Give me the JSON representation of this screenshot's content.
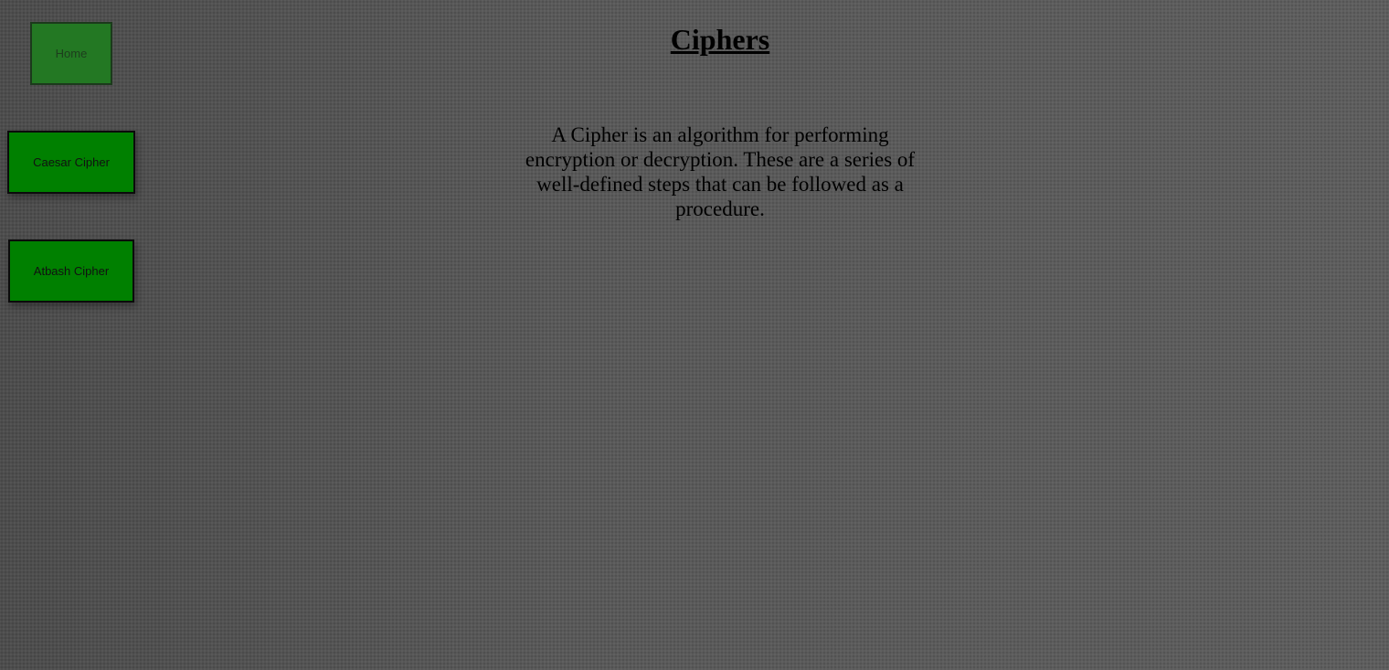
{
  "nav": {
    "home_label": "Home",
    "caesar_label": "Caesar Cipher",
    "atbash_label": "Atbash Cipher"
  },
  "main": {
    "title": "Ciphers",
    "description": "A Cipher is an algorithm for performing encryption or decryption. These are a series of well-defined steps that can be followed as a procedure."
  },
  "colors": {
    "background": "#555555",
    "button_green": "#008000",
    "button_home_green": "#237823"
  }
}
